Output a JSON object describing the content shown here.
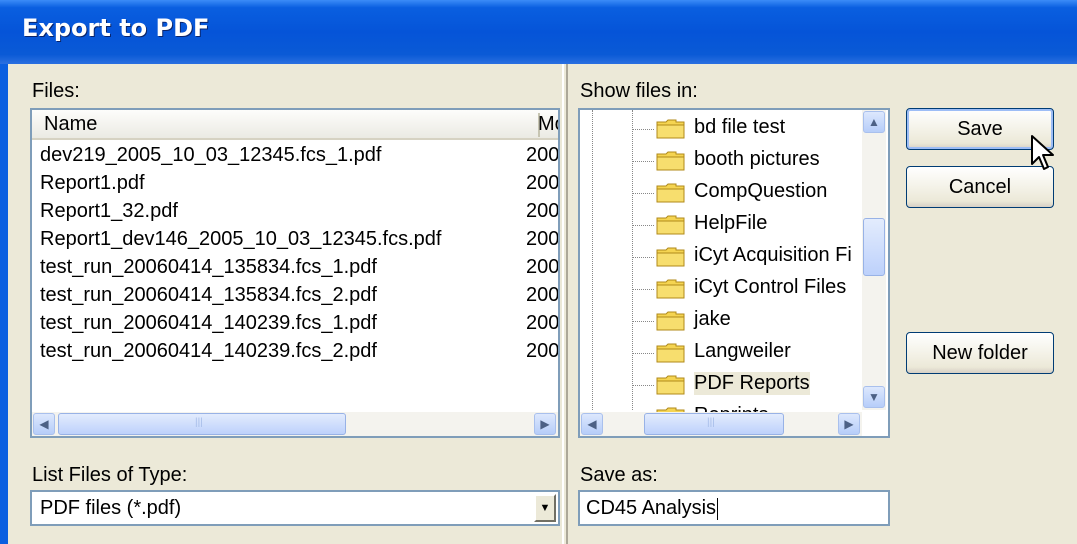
{
  "window": {
    "title": "Export to PDF"
  },
  "files_panel": {
    "label": "Files:",
    "columns": {
      "name": "Name",
      "modified": "Modified"
    },
    "rows": [
      {
        "name": "dev219_2005_10_03_12345.fcs_1.pdf",
        "modified": "200"
      },
      {
        "name": "Report1.pdf",
        "modified": "200"
      },
      {
        "name": "Report1_32.pdf",
        "modified": "200"
      },
      {
        "name": "Report1_dev146_2005_10_03_12345.fcs.pdf",
        "modified": "200"
      },
      {
        "name": "test_run_20060414_135834.fcs_1.pdf",
        "modified": "200"
      },
      {
        "name": "test_run_20060414_135834.fcs_2.pdf",
        "modified": "200"
      },
      {
        "name": "test_run_20060414_140239.fcs_1.pdf",
        "modified": "200"
      },
      {
        "name": "test_run_20060414_140239.fcs_2.pdf",
        "modified": "200"
      }
    ]
  },
  "folders_panel": {
    "label": "Show files in:",
    "folders": [
      {
        "name": "bd file test"
      },
      {
        "name": "booth pictures"
      },
      {
        "name": "CompQuestion"
      },
      {
        "name": "HelpFile"
      },
      {
        "name": "iCyt Acquisition Fi"
      },
      {
        "name": "iCyt Control Files"
      },
      {
        "name": "jake"
      },
      {
        "name": "Langweiler"
      },
      {
        "name": "PDF Reports",
        "selected": true
      },
      {
        "name": "Reprints"
      }
    ]
  },
  "file_type": {
    "label": "List Files of Type:",
    "value": "PDF files (*.pdf)"
  },
  "save_as": {
    "label": "Save as:",
    "value": "CD45 Analysis"
  },
  "buttons": {
    "save": "Save",
    "cancel": "Cancel",
    "new_folder": "New folder"
  },
  "icons": {
    "folder": "folder-icon",
    "cursor": "mouse-pointer-icon"
  },
  "colors": {
    "titlebar": "#0554d8",
    "dialog_bg": "#ece9d8",
    "folder_yellow": "#f5d451"
  }
}
